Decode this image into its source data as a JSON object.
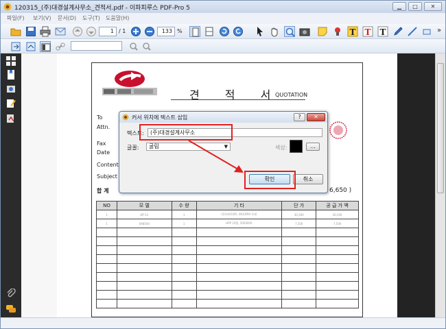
{
  "window": {
    "title": "120315_(주)대경설계사무소_견적서.pdf - 이파피루스 PDF-Pro 5"
  },
  "menu": {
    "items": [
      "파일(F)",
      "보기(V)",
      "문서(D)",
      "도구(T)",
      "도움말(H)"
    ]
  },
  "toolbar": {
    "page_value": "1",
    "page_total": "/ 1",
    "zoom_value": "133",
    "zoom_unit": "%",
    "overflow": "»"
  },
  "document": {
    "title": "견  적  서",
    "subtitle": "QUOTATION",
    "fields": {
      "to": "To",
      "attn": "Attn.",
      "fax": "Fax",
      "date": "Date",
      "content": "Content",
      "subject": "Subject",
      "total": "합  계",
      "total_value": "6,650 )"
    },
    "table": {
      "headers": [
        "NO",
        "모  델",
        "수  량",
        "기  타",
        "단  가",
        "공 급 가 액"
      ],
      "rows": [
        [
          "1",
          "DP-12",
          "1",
          "ℓ전자회로(B5, 8K)(DRH 1대)",
          "30,500",
          "30,500"
        ],
        [
          "1",
          "0A8500",
          "1",
          "HPP 10종, 5000000",
          "7,500",
          "7,500"
        ]
      ]
    }
  },
  "dialog": {
    "title": "커서 위치에 텍스트 삽입",
    "help": "?",
    "close": "✕",
    "text_label": "텍스트:",
    "text_value": "(주)대경설계사무소",
    "font_label": "글꼴:",
    "font_value": "굴림",
    "color_label": "색상:",
    "color_value": "#000000",
    "more": "...",
    "ok": "확인",
    "cancel": "취소"
  },
  "colors": {
    "annotation": "#e02020",
    "logo_red": "#c8102e"
  }
}
